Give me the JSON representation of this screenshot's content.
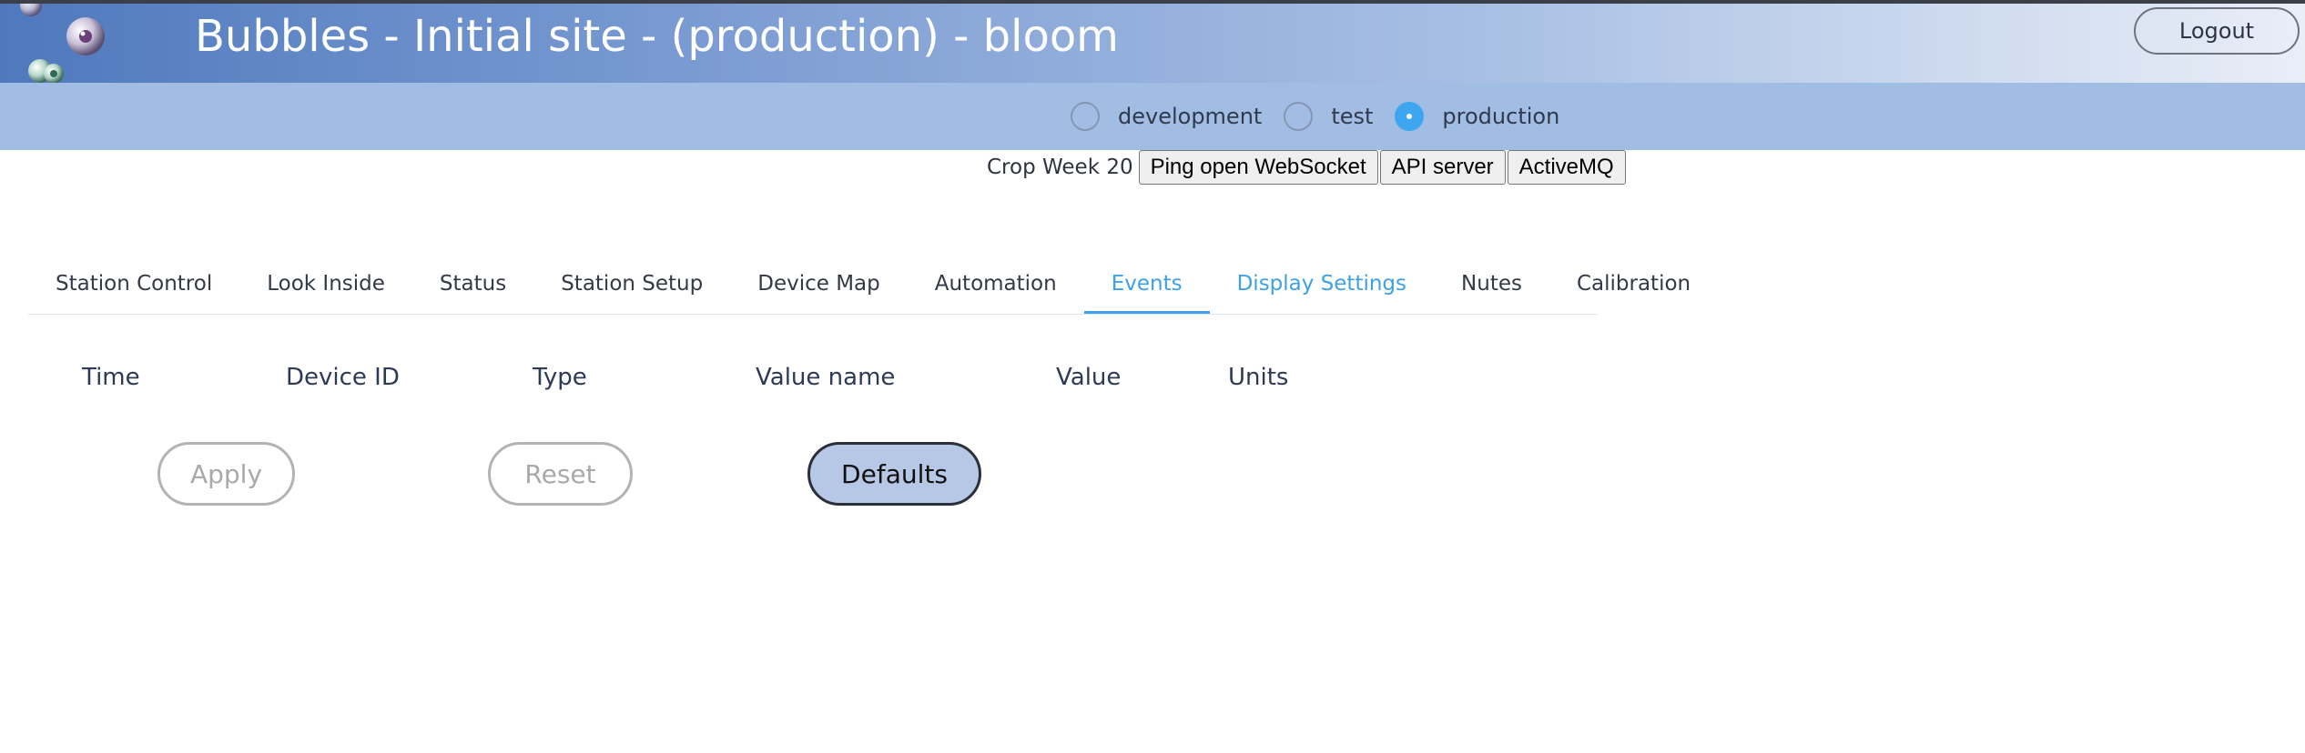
{
  "header": {
    "title": "Bubbles - Initial site - (production) - bloom",
    "logout_label": "Logout"
  },
  "environments": [
    {
      "label": "development",
      "selected": false
    },
    {
      "label": "test",
      "selected": false
    },
    {
      "label": "production",
      "selected": true
    }
  ],
  "status": {
    "crop_week": "Crop Week 20",
    "buttons": [
      "Ping open WebSocket",
      "API server",
      "ActiveMQ"
    ]
  },
  "tabs": [
    {
      "label": "Station Control"
    },
    {
      "label": "Look Inside"
    },
    {
      "label": "Status"
    },
    {
      "label": "Station Setup"
    },
    {
      "label": "Device Map"
    },
    {
      "label": "Automation"
    },
    {
      "label": "Events"
    },
    {
      "label": "Display Settings"
    },
    {
      "label": "Nutes"
    },
    {
      "label": "Calibration"
    }
  ],
  "active_tab": "Events",
  "table": {
    "columns": [
      "Time",
      "Device ID",
      "Type",
      "Value name",
      "Value",
      "Units"
    ]
  },
  "actions": {
    "apply_label": "Apply",
    "reset_label": "Reset",
    "defaults_label": "Defaults"
  },
  "colors": {
    "accent": "#3ea0e6",
    "env_bar": "#a2bde4",
    "header_start": "#4f79bd",
    "header_end": "#e9eef7",
    "primary_button": "#b7c8e6"
  },
  "icons": {
    "logo": "bubbles-logo-icon"
  }
}
